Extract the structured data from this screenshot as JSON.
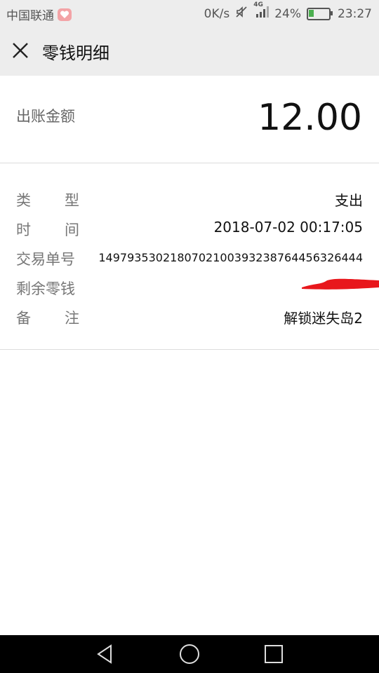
{
  "status_bar": {
    "carrier": "中国联通",
    "speed": "0K/s",
    "network": "4G",
    "battery_level": "24%",
    "battery_fraction": 0.24,
    "time": "23:27"
  },
  "header": {
    "title": "零钱明细",
    "close_icon": "close-icon"
  },
  "amount": {
    "label": "出账金额",
    "value": "12.00"
  },
  "details": [
    {
      "label_chars": [
        "类",
        "型"
      ],
      "value": "支出"
    },
    {
      "label_chars": [
        "时",
        "间"
      ],
      "value": "2018-07-02 00:17:05"
    },
    {
      "label_chars": [
        "交易单号"
      ],
      "value": "1497935302180702100393238764456326444"
    },
    {
      "label_chars": [
        "剩余零钱"
      ],
      "value": ""
    },
    {
      "label_chars": [
        "备",
        "注"
      ],
      "value": "解锁迷失岛2"
    }
  ],
  "navbar": {
    "back_icon": "back-triangle-icon",
    "home_icon": "home-circle-icon",
    "recents_icon": "recents-square-icon"
  },
  "colors": {
    "header_bg": "#ededed",
    "redaction": "#e8171c"
  }
}
